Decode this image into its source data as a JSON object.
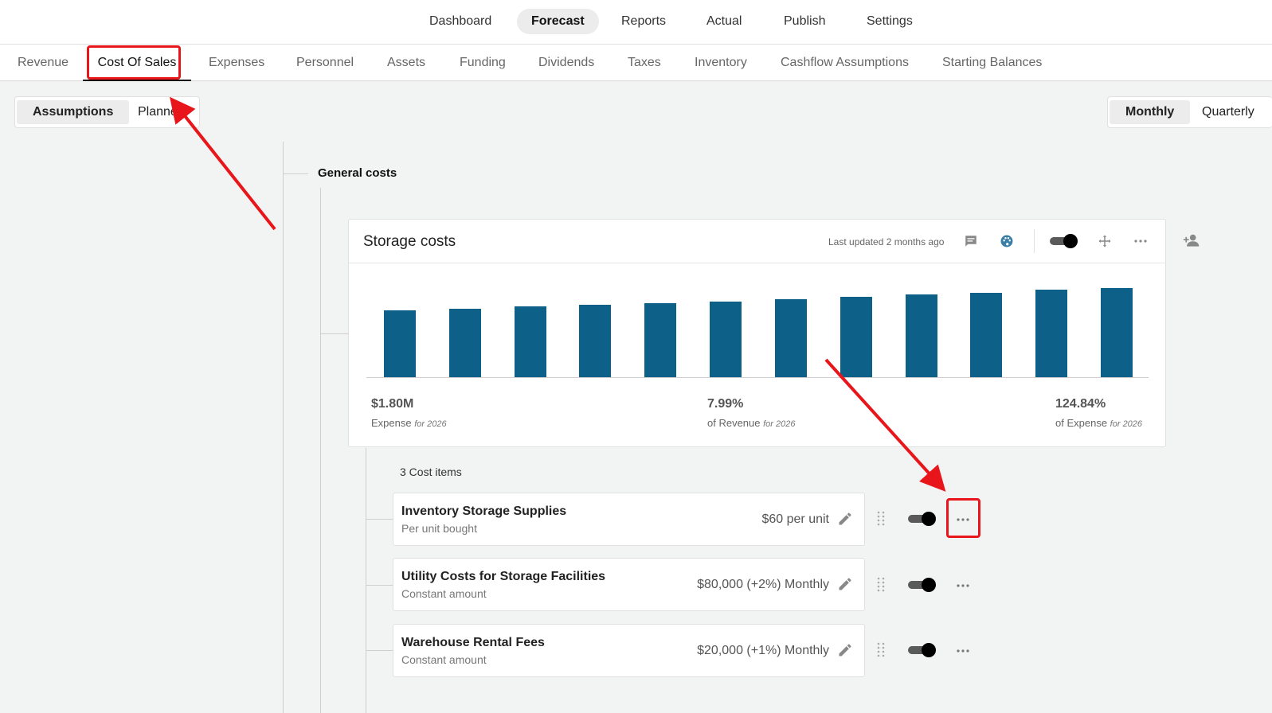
{
  "topnav": {
    "items": [
      {
        "label": "Dashboard",
        "active": false
      },
      {
        "label": "Forecast",
        "active": true
      },
      {
        "label": "Reports",
        "active": false
      },
      {
        "label": "Actual",
        "active": false
      },
      {
        "label": "Publish",
        "active": false
      },
      {
        "label": "Settings",
        "active": false
      }
    ]
  },
  "subnav": {
    "tabs": [
      {
        "label": "Revenue"
      },
      {
        "label": "Cost Of Sales",
        "active": true
      },
      {
        "label": "Expenses"
      },
      {
        "label": "Personnel"
      },
      {
        "label": "Assets"
      },
      {
        "label": "Funding"
      },
      {
        "label": "Dividends"
      },
      {
        "label": "Taxes"
      },
      {
        "label": "Inventory"
      },
      {
        "label": "Cashflow Assumptions"
      },
      {
        "label": "Starting Balances"
      }
    ]
  },
  "view_toggle": {
    "assumptions": "Assumptions",
    "planner": "Planne"
  },
  "period_toggle": {
    "monthly": "Monthly",
    "quarterly": "Quarterly"
  },
  "section": {
    "title": "General costs"
  },
  "card": {
    "title": "Storage costs",
    "last_updated": "Last updated 2 months ago",
    "stats": [
      {
        "value": "$1.80M",
        "label": "Expense",
        "period": "for 2026"
      },
      {
        "value": "7.99%",
        "label": "of Revenue",
        "period": "for 2026"
      },
      {
        "value": "124.84%",
        "label": "of Expense",
        "period": "for 2026"
      }
    ],
    "toggle_on": true
  },
  "chart_data": {
    "type": "bar",
    "categories": [
      "",
      "",
      "",
      "",
      "",
      "",
      "",
      "",
      "",
      "",
      "",
      ""
    ],
    "values": [
      77,
      79,
      82,
      83,
      85,
      87,
      90,
      93,
      95,
      97,
      101,
      103
    ],
    "ylim": [
      0,
      110
    ],
    "grid": false,
    "color": "#0d6189"
  },
  "cost_items": {
    "count_label": "3 Cost items",
    "items": [
      {
        "name": "Inventory Storage Supplies",
        "type": "Per unit bought",
        "value": "$60 per unit",
        "enabled": true
      },
      {
        "name": "Utility Costs for Storage Facilities",
        "type": "Constant amount",
        "value": "$80,000 (+2%) Monthly",
        "enabled": true
      },
      {
        "name": "Warehouse Rental Fees",
        "type": "Constant amount",
        "value": "$20,000 (+1%) Monthly",
        "enabled": true
      }
    ]
  },
  "icons": {
    "comment": "comment-icon",
    "palette": "palette-icon",
    "move": "move-icon",
    "more": "more-icon",
    "add_user": "add-user-icon",
    "edit": "pencil-icon",
    "drag": "drag-handle-icon"
  },
  "colors": {
    "accent_bar": "#0d6189",
    "highlight": "#e8161b"
  }
}
